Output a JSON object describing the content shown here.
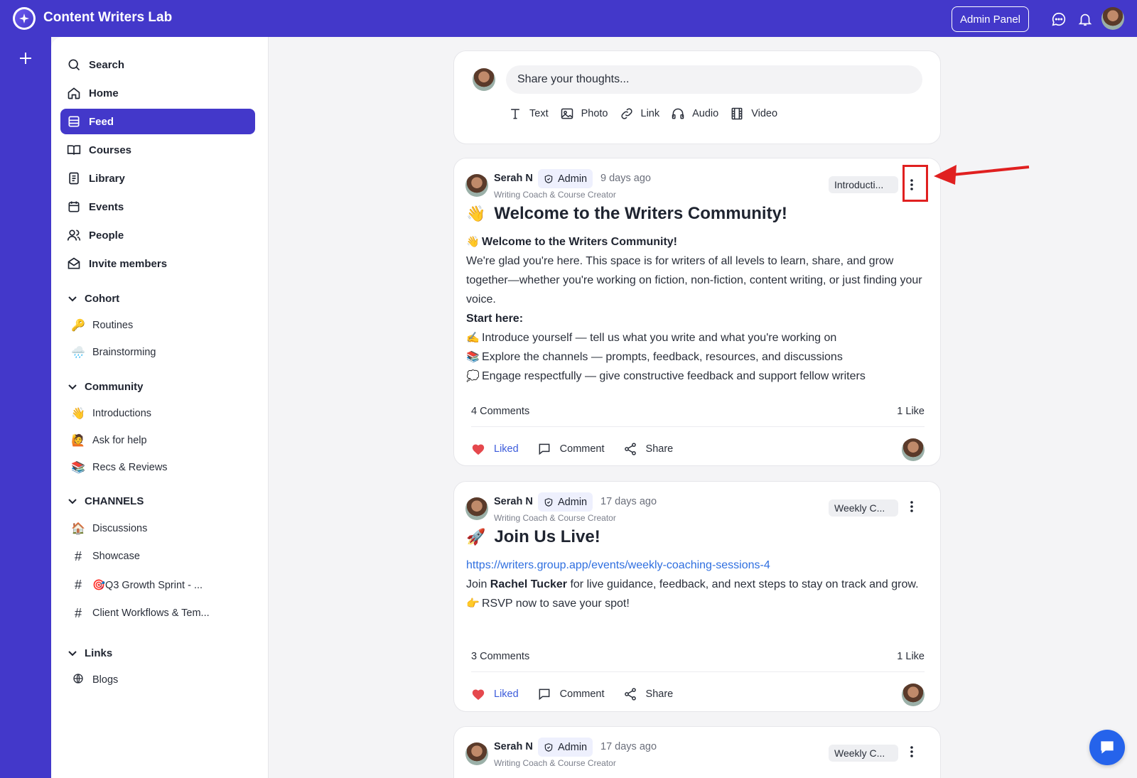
{
  "app": {
    "title": "Content Writers Lab",
    "brand_color": "#4338ca"
  },
  "topbar": {
    "admin_label": "Admin Panel"
  },
  "sidebar": {
    "nav": [
      {
        "label": "Search",
        "icon": "search-icon"
      },
      {
        "label": "Home",
        "icon": "home-icon"
      },
      {
        "label": "Feed",
        "icon": "feed-icon",
        "active": true
      },
      {
        "label": "Courses",
        "icon": "book-icon"
      },
      {
        "label": "Library",
        "icon": "library-icon"
      },
      {
        "label": "Events",
        "icon": "calendar-icon"
      },
      {
        "label": "People",
        "icon": "people-icon"
      },
      {
        "label": "Invite members",
        "icon": "mail-icon"
      }
    ],
    "cohort": {
      "title": "Cohort",
      "items": [
        {
          "emoji": "🔑",
          "label": "Routines"
        },
        {
          "emoji": "🌧️",
          "label": "Brainstorming"
        }
      ]
    },
    "community": {
      "title": "Community",
      "items": [
        {
          "emoji": "👋",
          "label": "Introductions"
        },
        {
          "emoji": "🙋",
          "label": "Ask for help"
        },
        {
          "emoji": "📚",
          "label": "Recs & Reviews"
        }
      ]
    },
    "channels": {
      "title": "CHANNELS",
      "items": [
        {
          "emoji": "🏠",
          "label": "Discussions"
        },
        {
          "hash": "#",
          "label": "Showcase"
        },
        {
          "hash": "#",
          "label": "🎯Q3 Growth Sprint - ..."
        },
        {
          "hash": "#",
          "label": "Client Workflows & Tem..."
        }
      ]
    },
    "links": {
      "title": "Links",
      "items": [
        {
          "label": "Blogs"
        }
      ]
    }
  },
  "composer": {
    "placeholder": "Share your thoughts...",
    "tools": [
      "Text",
      "Photo",
      "Link",
      "Audio",
      "Video"
    ]
  },
  "posts": [
    {
      "author": "Serah N",
      "badge": "Admin",
      "time": "9 days ago",
      "role": "Writing Coach & Course Creator",
      "channel": "Introducti...",
      "title_emoji": "👋",
      "title": "Welcome to the Writers Community!",
      "body": {
        "heading_emoji": "👋",
        "heading": "Welcome to the Writers Community!",
        "para": "We're glad you're here. This space is for writers of all levels to learn, share, and grow together—whether you're working on fiction, non-fiction, content writing, or just finding your voice.",
        "start": "Start here:",
        "bullets": [
          {
            "emoji": "✍️",
            "text": "Introduce yourself — tell us what you write and what you're working on"
          },
          {
            "emoji": "📚",
            "text": "Explore the channels — prompts, feedback, resources, and discussions"
          },
          {
            "emoji": "💭",
            "text": "Engage respectfully — give constructive feedback and support fellow writers"
          }
        ]
      },
      "comments": "4 Comments",
      "likes": "1 Like",
      "liked_label": "Liked",
      "comment_label": "Comment",
      "share_label": "Share"
    },
    {
      "author": "Serah N",
      "badge": "Admin",
      "time": "17 days ago",
      "role": "Writing Coach & Course Creator",
      "channel": "Weekly C...",
      "title_emoji": "🚀",
      "title": "Join Us Live!",
      "body": {
        "link": "https://writers.group.app/events/weekly-coaching-sessions-4",
        "pre": "Join ",
        "name": "Rachel Tucker",
        "post": " for live guidance, feedback, and next steps to stay on track and grow.",
        "rsvp_emoji": "👉",
        "rsvp": "RSVP now to save your spot!"
      },
      "comments": "3 Comments",
      "likes": "1 Like",
      "liked_label": "Liked",
      "comment_label": "Comment",
      "share_label": "Share"
    },
    {
      "author": "Serah N",
      "badge": "Admin",
      "time": "17 days ago",
      "role": "Writing Coach & Course Creator",
      "channel": "Weekly C..."
    }
  ]
}
